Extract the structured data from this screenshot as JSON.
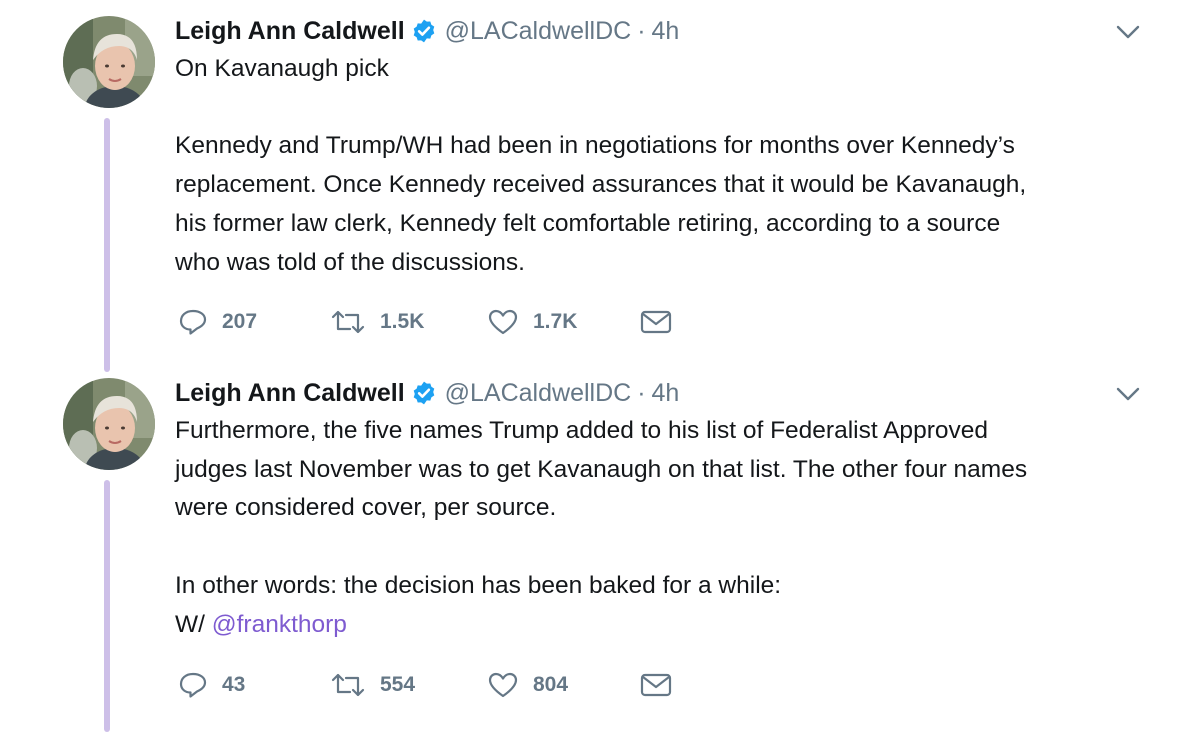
{
  "accent_color": "#7e5bd0",
  "thread_line_color": "#cdbfe8",
  "verified_color": "#1da1f2",
  "tweets": [
    {
      "author_name": "Leigh Ann Caldwell",
      "handle": "@LACaldwellDC",
      "separator": "·",
      "time": "4h",
      "lines": [
        "On Kavanaugh pick",
        "",
        "Kennedy and Trump/WH had been in negotiations for months over Kennedy’s",
        "replacement. Once Kennedy received assurances that it would be Kavanaugh,",
        "his former law clerk, Kennedy felt comfortable retiring, according to a source",
        "who was told of the discussions."
      ],
      "replies": "207",
      "retweets": "1.5K",
      "likes": "1.7K"
    },
    {
      "author_name": "Leigh Ann Caldwell",
      "handle": "@LACaldwellDC",
      "separator": "·",
      "time": "4h",
      "lines": [
        "Furthermore, the five names Trump added to his list of Federalist Approved",
        "judges last November was to get Kavanaugh on that list. The other four names",
        "were considered cover, per source.",
        "",
        "In other words: the decision has been baked for a while:"
      ],
      "last_line_prefix": "W/ ",
      "mention": "@frankthorp",
      "replies": "43",
      "retweets": "554",
      "likes": "804"
    }
  ]
}
